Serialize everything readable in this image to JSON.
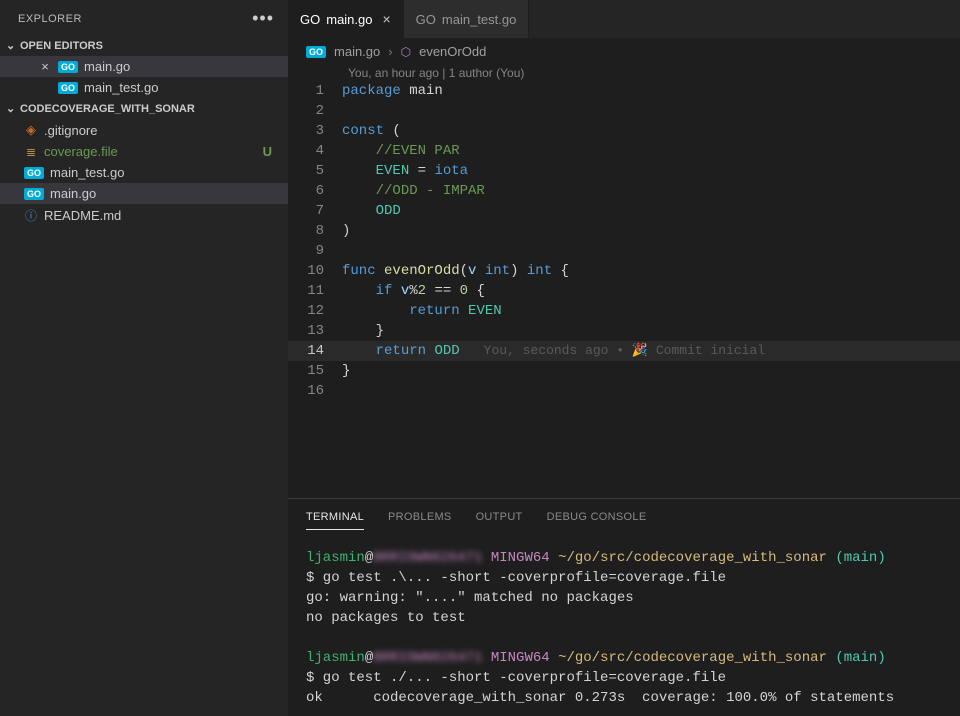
{
  "explorer": {
    "title": "EXPLORER",
    "sections": {
      "openEditors": {
        "label": "OPEN EDITORS",
        "items": [
          {
            "name": "main.go",
            "lang": "GO",
            "active": true
          },
          {
            "name": "main_test.go",
            "lang": "GO",
            "active": false
          }
        ]
      },
      "folder": {
        "label": "CODECOVERAGE_WITH_SONAR",
        "items": [
          {
            "name": ".gitignore",
            "icon": "git"
          },
          {
            "name": "coverage.file",
            "icon": "file",
            "status": "U",
            "green": true
          },
          {
            "name": "main_test.go",
            "icon": "go"
          },
          {
            "name": "main.go",
            "icon": "go",
            "active": true
          },
          {
            "name": "README.md",
            "icon": "info"
          }
        ]
      }
    }
  },
  "tabs": [
    {
      "name": "main.go",
      "lang": "GO",
      "active": true,
      "close": "×"
    },
    {
      "name": "main_test.go",
      "lang": "GO",
      "active": false
    }
  ],
  "breadcrumbs": {
    "file": "main.go",
    "symbol": "evenOrOdd"
  },
  "codelens": "You, an hour ago | 1 author (You)",
  "code": {
    "l1": {
      "n": "1",
      "tokens": [
        [
          "kw",
          "package "
        ],
        [
          "pln",
          "main"
        ]
      ]
    },
    "l2": {
      "n": "2",
      "tokens": []
    },
    "l3": {
      "n": "3",
      "tokens": [
        [
          "kw",
          "const"
        ],
        [
          "pln",
          " ("
        ]
      ]
    },
    "l4": {
      "n": "4",
      "tokens": [
        [
          "pln",
          "    "
        ],
        [
          "com",
          "//EVEN PAR"
        ]
      ]
    },
    "l5": {
      "n": "5",
      "tokens": [
        [
          "pln",
          "    "
        ],
        [
          "cst",
          "EVEN"
        ],
        [
          "pln",
          " = "
        ],
        [
          "kw",
          "iota"
        ]
      ]
    },
    "l6": {
      "n": "6",
      "tokens": [
        [
          "pln",
          "    "
        ],
        [
          "com",
          "//ODD - IMPAR"
        ]
      ]
    },
    "l7": {
      "n": "7",
      "tokens": [
        [
          "pln",
          "    "
        ],
        [
          "cst",
          "ODD"
        ]
      ]
    },
    "l8": {
      "n": "8",
      "tokens": [
        [
          "pln",
          ")"
        ]
      ]
    },
    "l9": {
      "n": "9",
      "tokens": []
    },
    "l10": {
      "n": "10",
      "tokens": [
        [
          "kw",
          "func "
        ],
        [
          "fn",
          "evenOrOdd"
        ],
        [
          "pln",
          "("
        ],
        [
          "id",
          "v"
        ],
        [
          "pln",
          " "
        ],
        [
          "typ",
          "int"
        ],
        [
          "pln",
          ") "
        ],
        [
          "typ",
          "int"
        ],
        [
          "pln",
          " {"
        ]
      ]
    },
    "l11": {
      "n": "11",
      "tokens": [
        [
          "pln",
          "    "
        ],
        [
          "kw",
          "if"
        ],
        [
          "pln",
          " "
        ],
        [
          "id",
          "v"
        ],
        [
          "pln",
          "%"
        ],
        [
          "num",
          "2"
        ],
        [
          "pln",
          " == "
        ],
        [
          "num",
          "0"
        ],
        [
          "pln",
          " {"
        ]
      ]
    },
    "l12": {
      "n": "12",
      "tokens": [
        [
          "pln",
          "        "
        ],
        [
          "kw",
          "return"
        ],
        [
          "pln",
          " "
        ],
        [
          "cst",
          "EVEN"
        ]
      ]
    },
    "l13": {
      "n": "13",
      "tokens": [
        [
          "pln",
          "    }"
        ]
      ]
    },
    "l14": {
      "n": "14",
      "tokens": [
        [
          "pln",
          "    "
        ],
        [
          "kw",
          "return"
        ],
        [
          "pln",
          " "
        ],
        [
          "cst",
          "ODD"
        ]
      ],
      "blame": "You, seconds ago • 🎉  Commit inicial"
    },
    "l15": {
      "n": "15",
      "tokens": [
        [
          "pln",
          "}"
        ]
      ]
    },
    "l16": {
      "n": "16",
      "tokens": []
    }
  },
  "panel": {
    "tabs": [
      "TERMINAL",
      "PROBLEMS",
      "OUTPUT",
      "DEBUG CONSOLE"
    ],
    "active": 0
  },
  "terminal": {
    "user": "ljasmin",
    "host": "BRRIOWN026471",
    "shell": "MINGW64",
    "path": "~/go/src/codecoverage_with_sonar",
    "branch": "(main)",
    "lines": [
      "$ go test .\\... -short -coverprofile=coverage.file",
      "go: warning: \"....\" matched no packages",
      "no packages to test",
      "",
      "$ go test ./... -short -coverprofile=coverage.file",
      "ok      codecoverage_with_sonar 0.273s  coverage: 100.0% of statements"
    ]
  }
}
